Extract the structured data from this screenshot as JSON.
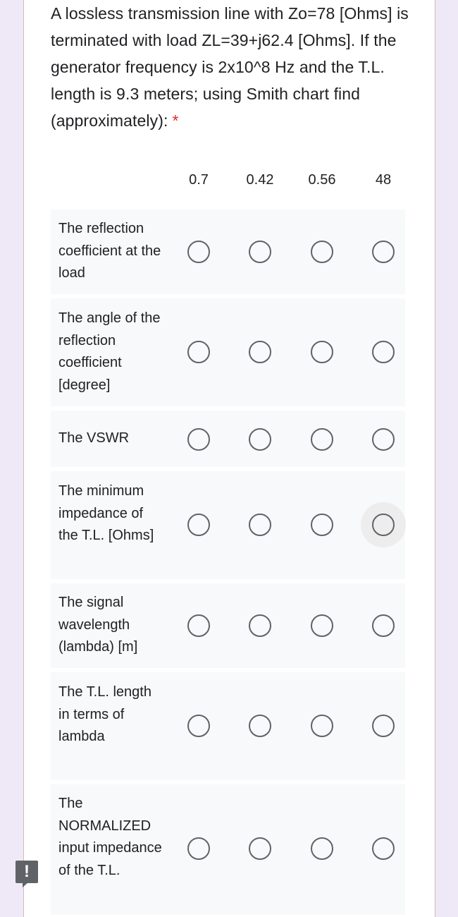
{
  "question": {
    "text": "A lossless transmission line with Zo=78 [Ohms] is terminated with load ZL=39+j62.4 [Ohms]. If the generator frequency is 2x10^8 Hz and the T.L. length is 9.3 meters; using Smith chart find (approximately):",
    "required_mark": "*"
  },
  "columns": [
    "0.7",
    "0.42",
    "0.56",
    "48"
  ],
  "rows": [
    {
      "label": "The reflection coefficient at the load",
      "selected": null
    },
    {
      "label": "The angle of the reflection coefficient [degree]",
      "selected": null
    },
    {
      "label": "The VSWR",
      "selected": null
    },
    {
      "label": "The minimum impedance of the T.L. [Ohms]",
      "selected": null
    },
    {
      "label": "The signal wavelength (lambda) [m]",
      "selected": null
    },
    {
      "label": "The T.L. length in terms of lambda",
      "selected": null
    },
    {
      "label": "The NORMALIZED input impedance of the T.L.",
      "selected": null
    }
  ],
  "report_icon": "report-problem-icon",
  "colors": {
    "background": "#efe9f7",
    "card": "#ffffff",
    "row_background": "#f8f9fa",
    "radio_border": "#5f6368",
    "required": "#d93025",
    "text": "#202124"
  }
}
